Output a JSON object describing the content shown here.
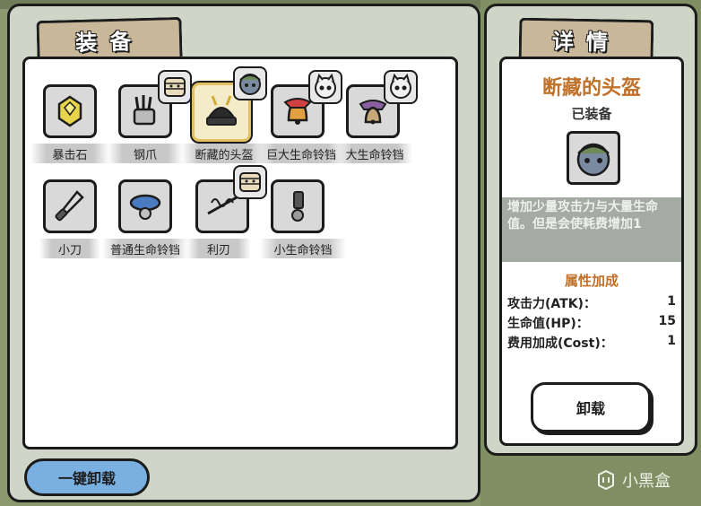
{
  "left_panel": {
    "tab_title": "装备",
    "unequip_all_label": "一键卸载"
  },
  "inventory": [
    {
      "name": "暴击石",
      "icon": "gem-icon"
    },
    {
      "name": "钢爪",
      "icon": "steel-claw-icon"
    },
    {
      "name": "断藏的头盔",
      "icon": "samurai-helmet-icon",
      "selected": true
    },
    {
      "name": "巨大生命铃铛",
      "icon": "large-bell-icon"
    },
    {
      "name": "大生命铃铛",
      "icon": "bell-icon"
    },
    {
      "name": "小刀",
      "icon": "knife-icon"
    },
    {
      "name": "普通生命铃铛",
      "icon": "collar-bell-icon"
    },
    {
      "name": "利刃",
      "icon": "blade-spring-icon"
    },
    {
      "name": "小生命铃铛",
      "icon": "small-bell-icon"
    }
  ],
  "right_panel": {
    "tab_title": "详情",
    "item_name": "断藏的头盔",
    "status": "已装备",
    "description": "增加少量攻击力与大量生命值。但是会使耗费增加1",
    "attr_title": "属性加成",
    "attributes": [
      {
        "label": "攻击力(ATK)：",
        "value": "1"
      },
      {
        "label": "生命值(HP)：",
        "value": "15"
      },
      {
        "label": "费用加成(Cost)：",
        "value": "1"
      }
    ],
    "unequip_label": "卸载"
  },
  "watermark": {
    "text": "小黑盒"
  },
  "colors": {
    "panel_bg": "#cfd6c8",
    "tab_bg": "#c9b79a",
    "accent_orange": "#c07028",
    "button_blue": "#7ab0e0",
    "desc_bg": "#a5aaa5"
  }
}
